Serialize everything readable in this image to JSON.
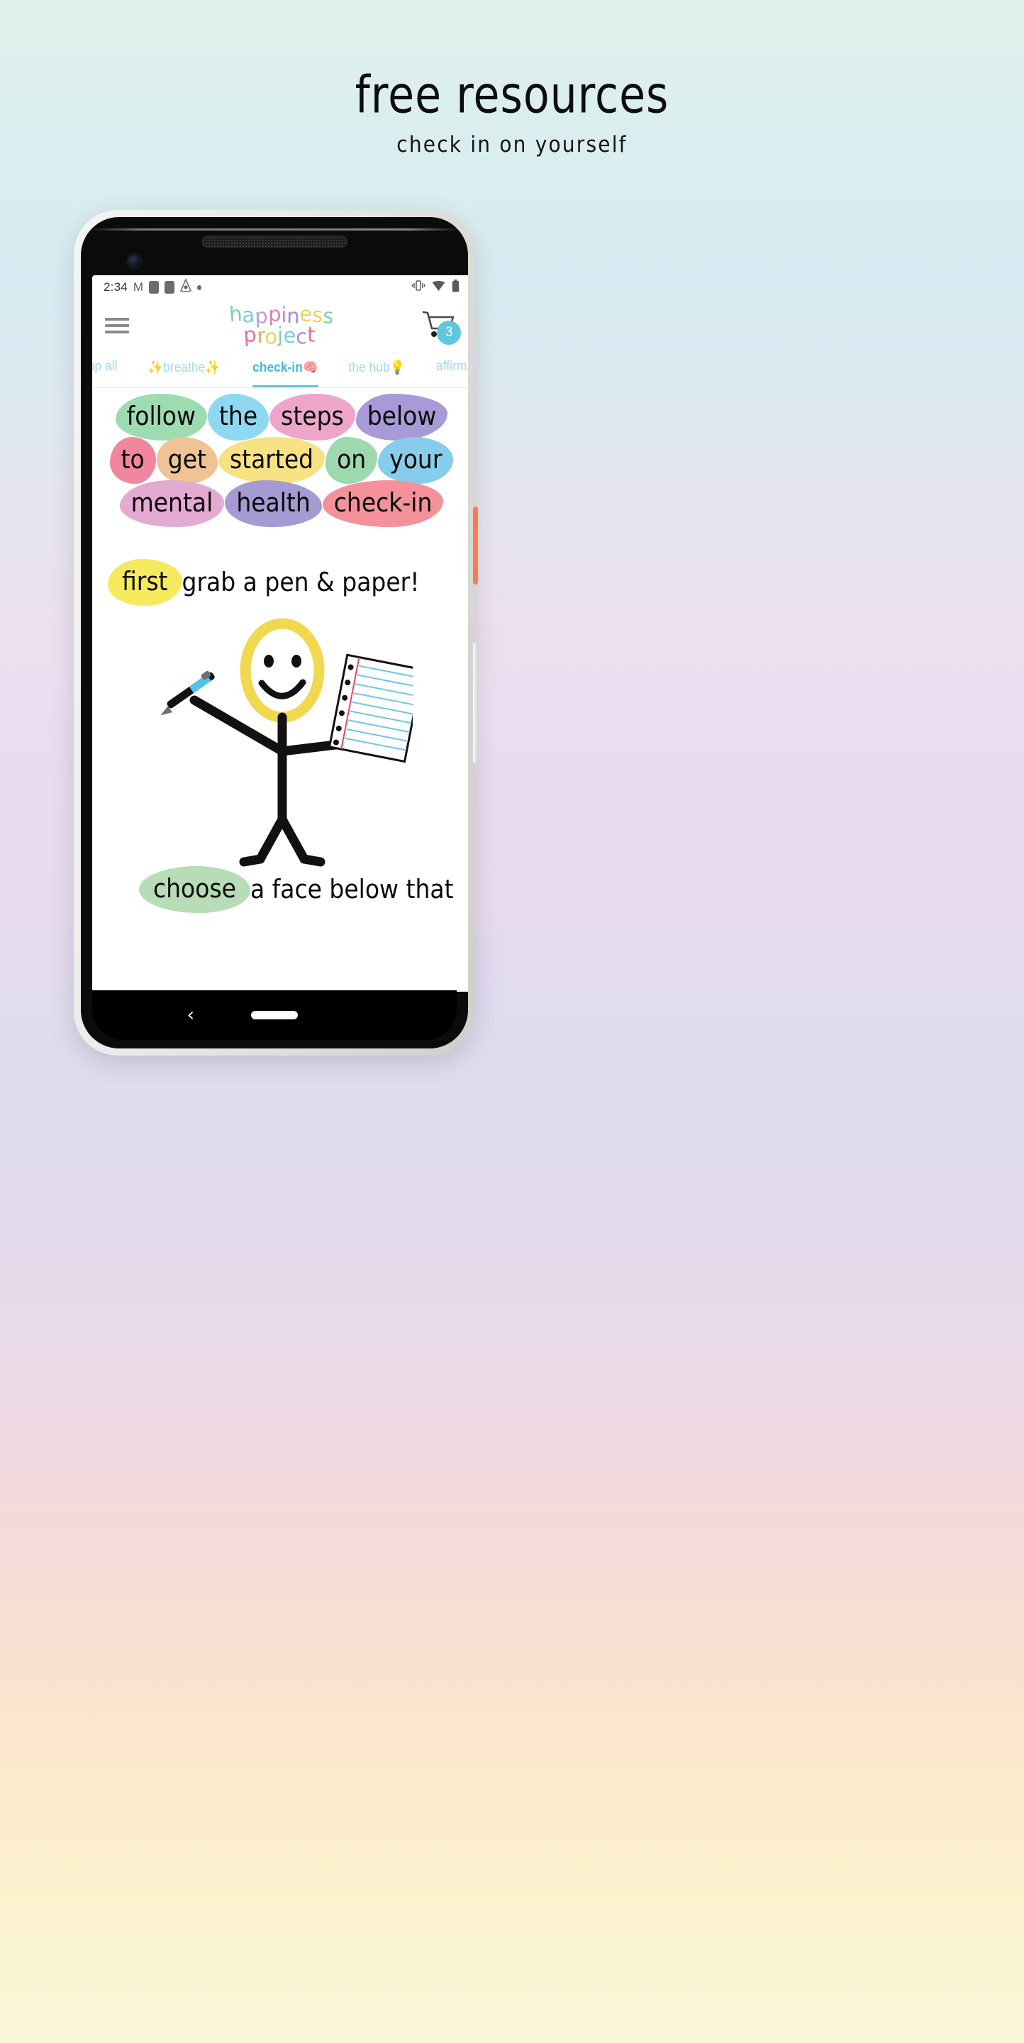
{
  "page": {
    "title": "free resources",
    "subtitle": "check in on yourself"
  },
  "device": {
    "statusbar": {
      "time": "2:34",
      "icons_left": [
        "gmail-icon",
        "app-square-icon",
        "app-square-icon",
        "drive-triangle-icon",
        "dot-icon"
      ],
      "icons_right": [
        "vibrate-icon",
        "wifi-icon",
        "battery-icon"
      ]
    },
    "buttons": {
      "power_color": "#fa7b52",
      "volume_color": "#f0f0ee"
    },
    "android_nav": {
      "back_glyph": "‹",
      "home_pill": "home-pill"
    }
  },
  "app": {
    "menu_label": "menu",
    "logo": {
      "line1": "happiness",
      "line2": "project",
      "line1_letters": [
        {
          "ch": "h",
          "color": "#86cfa0"
        },
        {
          "ch": "a",
          "color": "#7ecbe8"
        },
        {
          "ch": "p",
          "color": "#b79ee0"
        },
        {
          "ch": "p",
          "color": "#e87fae"
        },
        {
          "ch": "i",
          "color": "#e87fae"
        },
        {
          "ch": "n",
          "color": "#9b8fd8"
        },
        {
          "ch": "e",
          "color": "#f0cf5a"
        },
        {
          "ch": "s",
          "color": "#f0cf5a"
        },
        {
          "ch": "s",
          "color": "#86cfa0"
        }
      ],
      "line2_letters": [
        {
          "ch": "p",
          "color": "#ef6f96"
        },
        {
          "ch": "r",
          "color": "#f0a35c"
        },
        {
          "ch": "o",
          "color": "#f0cf5a"
        },
        {
          "ch": "j",
          "color": "#86cfa0"
        },
        {
          "ch": "e",
          "color": "#7ecbe8"
        },
        {
          "ch": "c",
          "color": "#a98fd8"
        },
        {
          "ch": "t",
          "color": "#ef6f96"
        }
      ]
    },
    "cart": {
      "icon": "shopping-cart-icon",
      "count": "3",
      "badge_color": "#5ec7e0"
    },
    "tabs": [
      {
        "label": "shop all",
        "active": false
      },
      {
        "label": "✨breathe✨",
        "active": false
      },
      {
        "label": "check-in🧠",
        "active": true
      },
      {
        "label": "the hub💡",
        "active": false
      },
      {
        "label": "affirmations",
        "active": false
      }
    ],
    "tab_colors": {
      "inactive": "#9fd8ef",
      "active": "#3cb9e0",
      "underline": "#5ec7e0"
    },
    "headline": {
      "line1": [
        {
          "text": "follow",
          "color": "#9ddbb0"
        },
        {
          "text": "the",
          "color": "#8ed8f2"
        },
        {
          "text": "steps",
          "color": "#eda6ca"
        },
        {
          "text": "below",
          "color": "#a89ad6"
        }
      ],
      "line2": [
        {
          "text": "to",
          "color": "#f0879f"
        },
        {
          "text": "get",
          "color": "#efc394"
        },
        {
          "text": "started",
          "color": "#f7e283"
        },
        {
          "text": "on",
          "color": "#9ed8ae"
        },
        {
          "text": "your",
          "color": "#86cdeb"
        }
      ],
      "line3": [
        {
          "text": "mental",
          "color": "#e3aad2"
        },
        {
          "text": "health",
          "color": "#a69ad2"
        },
        {
          "text": "check-in",
          "color": "#f4919a"
        }
      ]
    },
    "steps": [
      {
        "highlight": "first",
        "highlight_color": "#f5ea5e",
        "rest": "grab a pen & paper!"
      },
      {
        "highlight": "choose",
        "highlight_color": "#b6ddb6",
        "rest": "a face below that"
      }
    ],
    "illustration": {
      "name": "stick-figure-with-pen-and-paper",
      "head_color": "#f0d84f",
      "pen_color": "#4fc3e8",
      "paper_line_color": "#6ec6e8",
      "paper_margin_color": "#e8455f"
    }
  }
}
